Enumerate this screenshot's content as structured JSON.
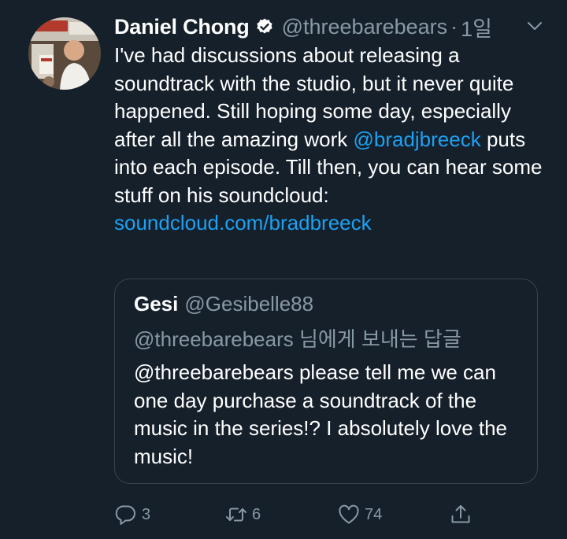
{
  "tweet": {
    "author": {
      "display_name": "Daniel Chong",
      "handle": "@threebarebears",
      "verified": true,
      "avatar_icon": "profile-photo"
    },
    "separator": "·",
    "time": "1일",
    "text": {
      "part1": "I've had discussions about releasing a soundtrack with the studio, but it never quite happened. Still hoping some day, especially after all the amazing work ",
      "mention": "@bradjbreeck",
      "part2": " puts into each episode. Till then, you can hear some stuff on his soundcloud: ",
      "link": "soundcloud.com/bradbreeck"
    },
    "quoted": {
      "display_name": "Gesi",
      "handle": "@Gesibelle88",
      "reply_to": "@threebarebears 님에게 보내는 답글",
      "text": "@threebarebears please tell me we can one day purchase a soundtrack of the music in the series!? I absolutely love the music!"
    },
    "actions": {
      "reply_count": "3",
      "retweet_count": "6",
      "like_count": "74"
    }
  },
  "colors": {
    "background": "#15202b",
    "secondary_text": "#8899a6",
    "link": "#1da1f2",
    "border": "#38444d"
  }
}
